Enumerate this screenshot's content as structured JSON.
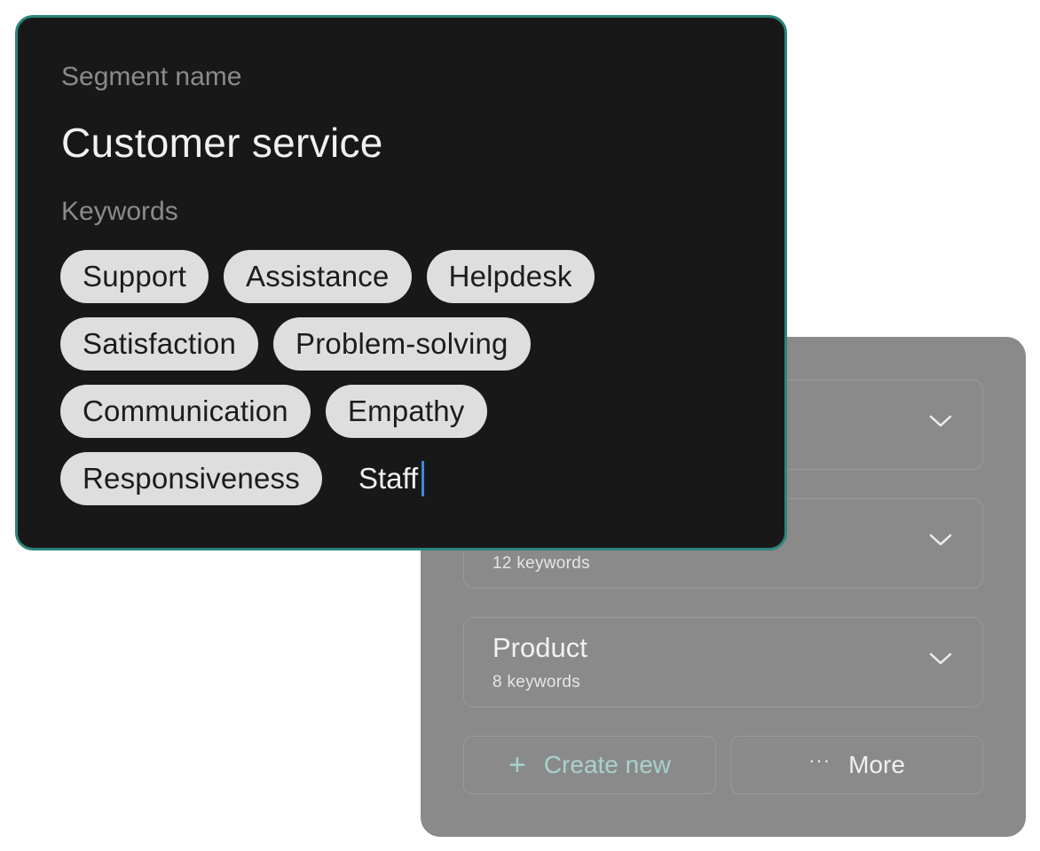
{
  "segment_list": {
    "rows": [
      {
        "title": "",
        "count": ""
      },
      {
        "title": "",
        "count": "12  keywords"
      },
      {
        "title": "Product",
        "count": "8  keywords"
      }
    ],
    "create_button": {
      "icon": "plus-icon",
      "glyph": "+",
      "label": "Create new"
    },
    "more_button": {
      "icon": "more-dots-icon",
      "glyph": "···",
      "label": "More"
    }
  },
  "editor": {
    "name_label": "Segment name",
    "name_value": "Customer service",
    "keywords_label": "Keywords",
    "keyword_lines": [
      [
        "Support",
        "Assistance",
        "Helpdesk"
      ],
      [
        "Satisfaction",
        "Problem-solving"
      ],
      [
        "Communication",
        "Empathy"
      ],
      [
        "Responsiveness"
      ]
    ],
    "keyword_input_value": "Staff"
  },
  "colors": {
    "card_background": "#181818",
    "card_border": "#2a857a",
    "chip_background": "#dedede",
    "panel_background": "#8a8a8a",
    "create_accent": "#a8d2cc",
    "caret": "#3b8bd6"
  }
}
